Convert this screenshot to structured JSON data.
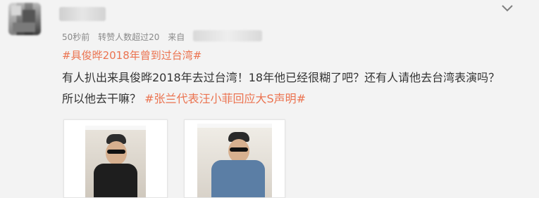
{
  "post": {
    "chevron_icon": "chevron-down-icon",
    "meta": {
      "time": "50秒前",
      "repost": "转赞人数超过20",
      "from_label": "来自"
    },
    "topic": "#具俊晔2018年曾到过台湾#",
    "content": {
      "line1": "有人扒出来具俊晔2018年去过台湾！18年他已经很糊了吧？还有人请他去台湾表演吗？",
      "line2_prefix": "所以他去干嘛？",
      "line2_topic": "#张兰代表汪小菲回应大S声明#"
    },
    "colors": {
      "topic": "#eb7350",
      "meta": "#8a8a8a",
      "text": "#333333",
      "background": "#f3f3f3"
    }
  }
}
